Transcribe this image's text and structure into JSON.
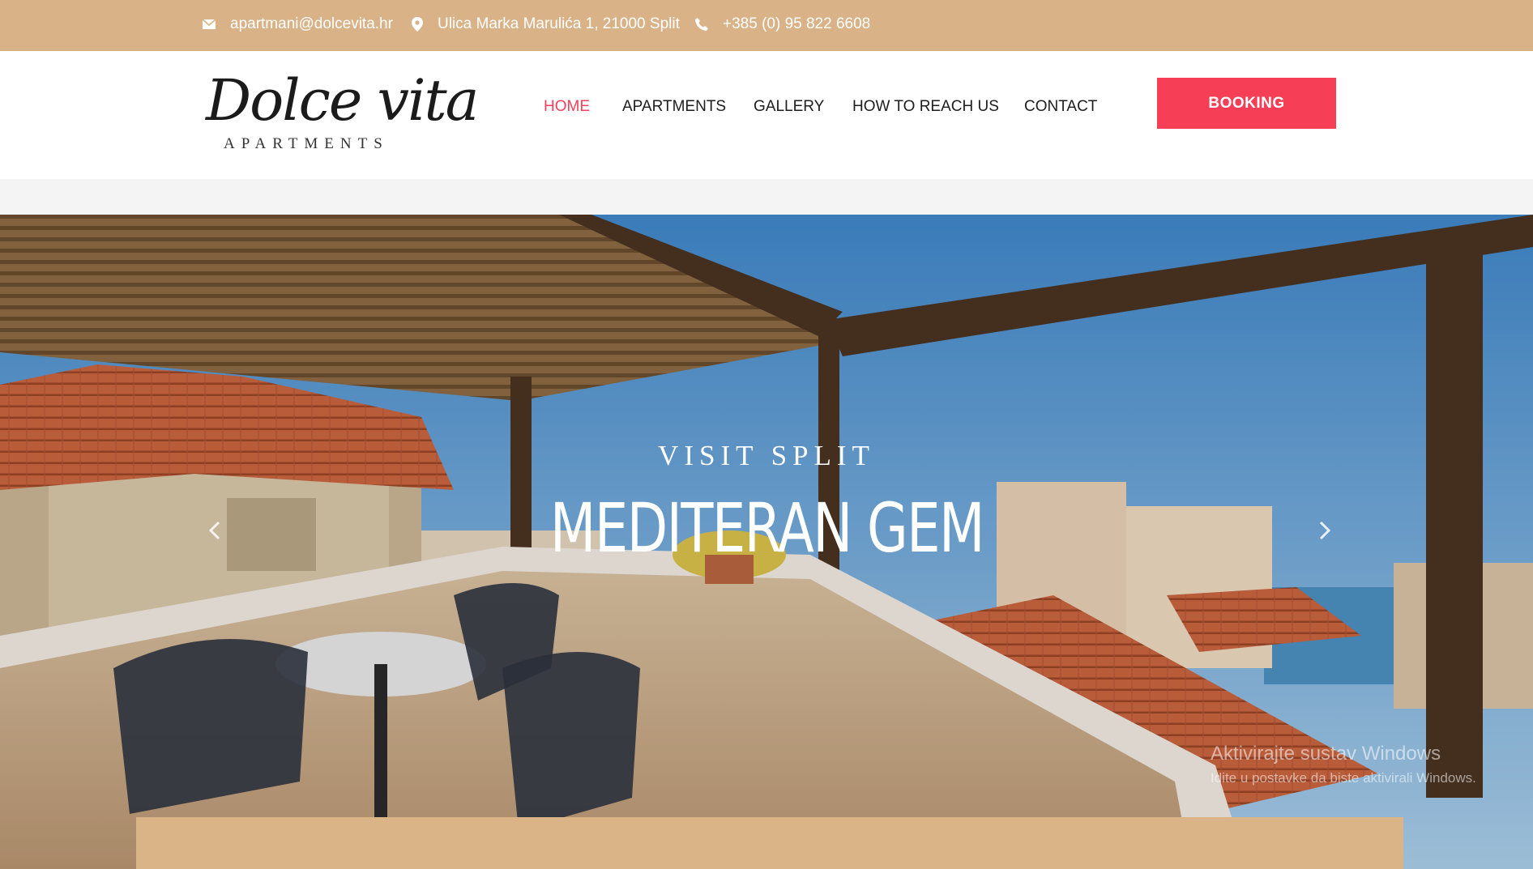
{
  "topbar": {
    "email": "apartmani@dolcevita.hr",
    "address": "Ulica Marka Marulića 1, 21000 Split",
    "phone": "+385 (0) 95 822 6608"
  },
  "logo": {
    "script": "Dolce vita",
    "sub": "APARTMENTS"
  },
  "nav": {
    "items": [
      "HOME",
      "APARTMENTS",
      "GALLERY",
      "HOW TO REACH US",
      "CONTACT"
    ],
    "active": "HOME",
    "active_color": "#f0405a"
  },
  "booking": {
    "label": "BOOKING",
    "color": "#f73e57"
  },
  "hero": {
    "kicker": "VISIT SPLIT",
    "headline": "MEDITERAN GEM",
    "prev_icon": "chevron-left-icon",
    "next_icon": "chevron-right-icon"
  },
  "watermark": {
    "line1": "Aktivirajte sustav Windows",
    "line2": "Idite u postavke da biste aktivirali Windows."
  },
  "colors": {
    "accent_tan": "#d9b287",
    "booking_red": "#f73e57"
  }
}
